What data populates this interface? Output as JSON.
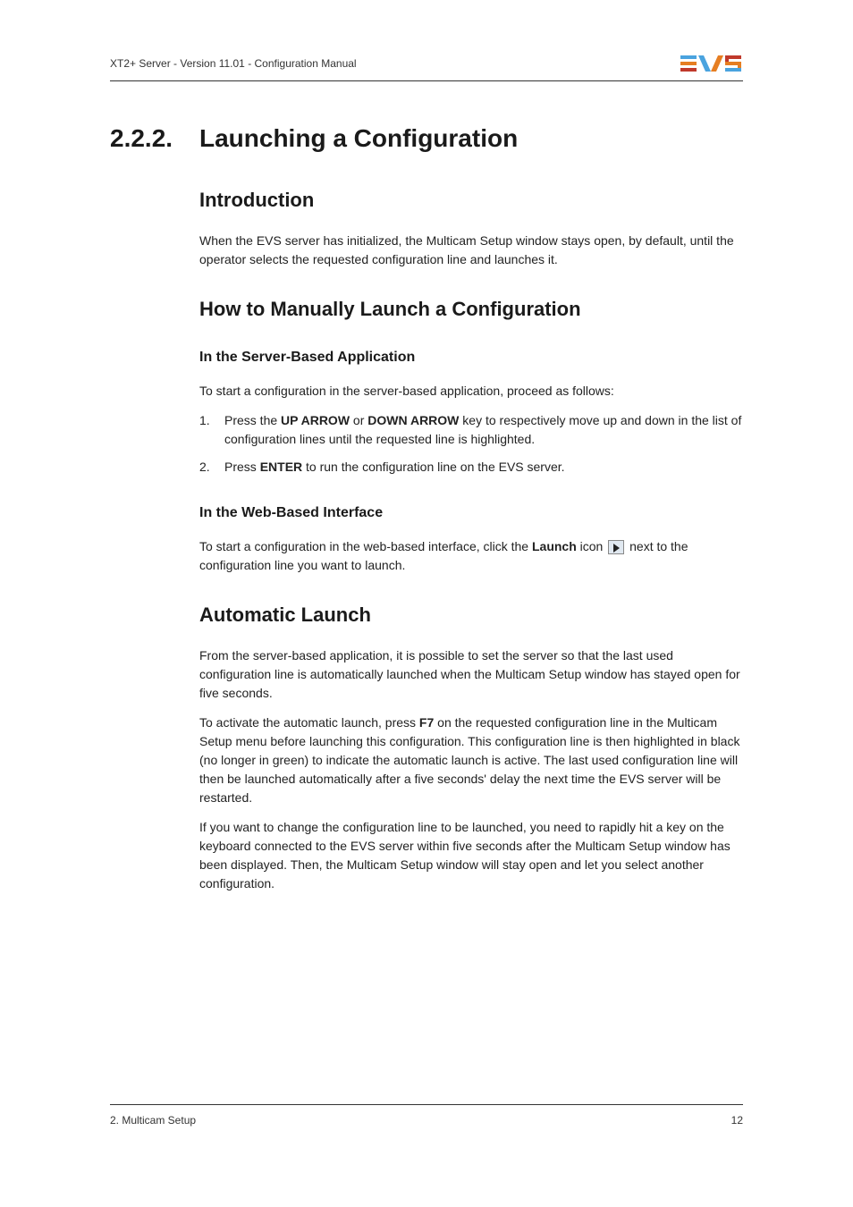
{
  "header": {
    "text": "XT2+ Server - Version 11.01 - Configuration Manual"
  },
  "heading": {
    "number": "2.2.2.",
    "title": "Launching a Configuration"
  },
  "intro": {
    "heading": "Introduction",
    "text": "When the EVS server has initialized, the Multicam Setup window stays open, by default, until the operator selects the requested configuration line and launches it."
  },
  "manual": {
    "heading": "How to Manually Launch a Configuration",
    "server": {
      "heading": "In the Server-Based Application",
      "intro": "To start a configuration in the server-based application, proceed as follows:",
      "step1_a": "Press the ",
      "step1_b": "UP ARROW",
      "step1_c": " or ",
      "step1_d": "DOWN ARROW",
      "step1_e": " key to respectively move up and down in the list of configuration lines until the requested line is highlighted.",
      "step2_a": "Press ",
      "step2_b": "ENTER",
      "step2_c": " to run the configuration line on the EVS server."
    },
    "web": {
      "heading": "In the Web-Based Interface",
      "text_a": "To start a configuration in the web-based interface, click the ",
      "text_b": "Launch",
      "text_c": " icon ",
      "text_d": " next to the configuration line you want to launch."
    }
  },
  "auto": {
    "heading": "Automatic Launch",
    "p1": "From the server-based application, it is possible to set the server so that the last used configuration line is automatically launched when the Multicam Setup window has stayed open for five seconds.",
    "p2_a": "To activate the automatic launch, press ",
    "p2_b": "F7",
    "p2_c": " on the requested configuration line in the Multicam Setup menu before launching this configuration. This configuration line is then highlighted in black (no longer in green) to indicate the automatic launch is active. The last used configuration line will then be launched automatically after a five seconds' delay the next time the EVS server will be restarted.",
    "p3": "If you want to change the configuration line to be launched, you need to rapidly hit a key on the keyboard connected to the EVS server within five seconds after the Multicam Setup window has been displayed. Then, the Multicam Setup window will stay open and let you select another configuration."
  },
  "footer": {
    "left": "2. Multicam Setup",
    "right": "12"
  }
}
